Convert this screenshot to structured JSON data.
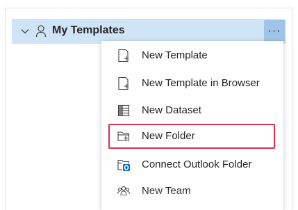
{
  "header": {
    "title": "My Templates",
    "more_label": "···"
  },
  "menu": {
    "items": [
      {
        "label": "New Template",
        "icon": "new-template-icon"
      },
      {
        "label": "New Template in Browser",
        "icon": "new-template-browser-icon"
      },
      {
        "label": "New Dataset",
        "icon": "dataset-icon"
      },
      {
        "label": "New Folder",
        "icon": "new-folder-icon",
        "highlighted": true
      },
      {
        "label": "Connect Outlook Folder",
        "icon": "outlook-folder-icon"
      },
      {
        "label": "New Team",
        "icon": "team-icon"
      }
    ]
  },
  "colors": {
    "header_bg": "#cfe4f7",
    "more_button_bg": "#9ec5e8",
    "highlight_border": "#d9304f",
    "outlook_blue": "#0f6cbd"
  }
}
